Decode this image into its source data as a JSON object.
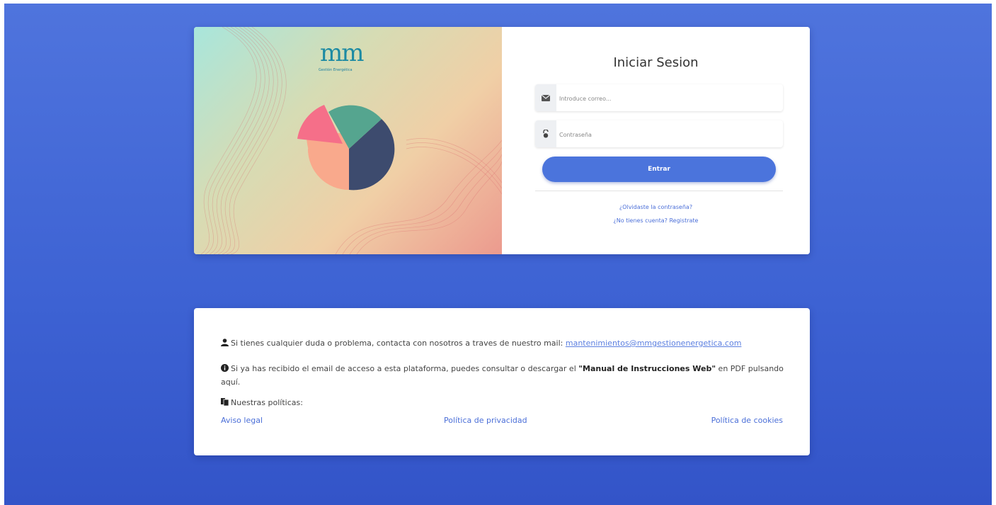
{
  "colors": {
    "background": "#4466d8",
    "accent": "#4b74dc",
    "link": "#4b6fd8"
  },
  "logo": {
    "mark": "mm",
    "subtitle": "Gestión Energética"
  },
  "login": {
    "title": "Iniciar Sesion",
    "email_placeholder": "Introduce correo...",
    "password_placeholder": "Contraseña",
    "email_icon": "envelope-icon",
    "password_icon": "lock-icon",
    "submit_label": "Entrar",
    "forgot_link": "¿Olvidaste la contraseña?",
    "register_link": "¿No tienes cuenta? Registrate"
  },
  "info": {
    "contact_text": "Si tienes cualquier duda o problema, contacta con nosotros a traves de nuestro mail:",
    "contact_email": "mantenimientos@mmgestionenergetica.com",
    "manual_text_before": "Si ya has recibido el email de acceso a esta plataforma, puedes consultar o descargar el",
    "manual_title": "\"Manual de Instrucciones Web\"",
    "manual_text_after": "en PDF pulsando aquí.",
    "policies_label": "Nuestras políticas:",
    "policy_links": [
      "Aviso legal",
      "Política de privacidad",
      "Política de cookies"
    ]
  }
}
